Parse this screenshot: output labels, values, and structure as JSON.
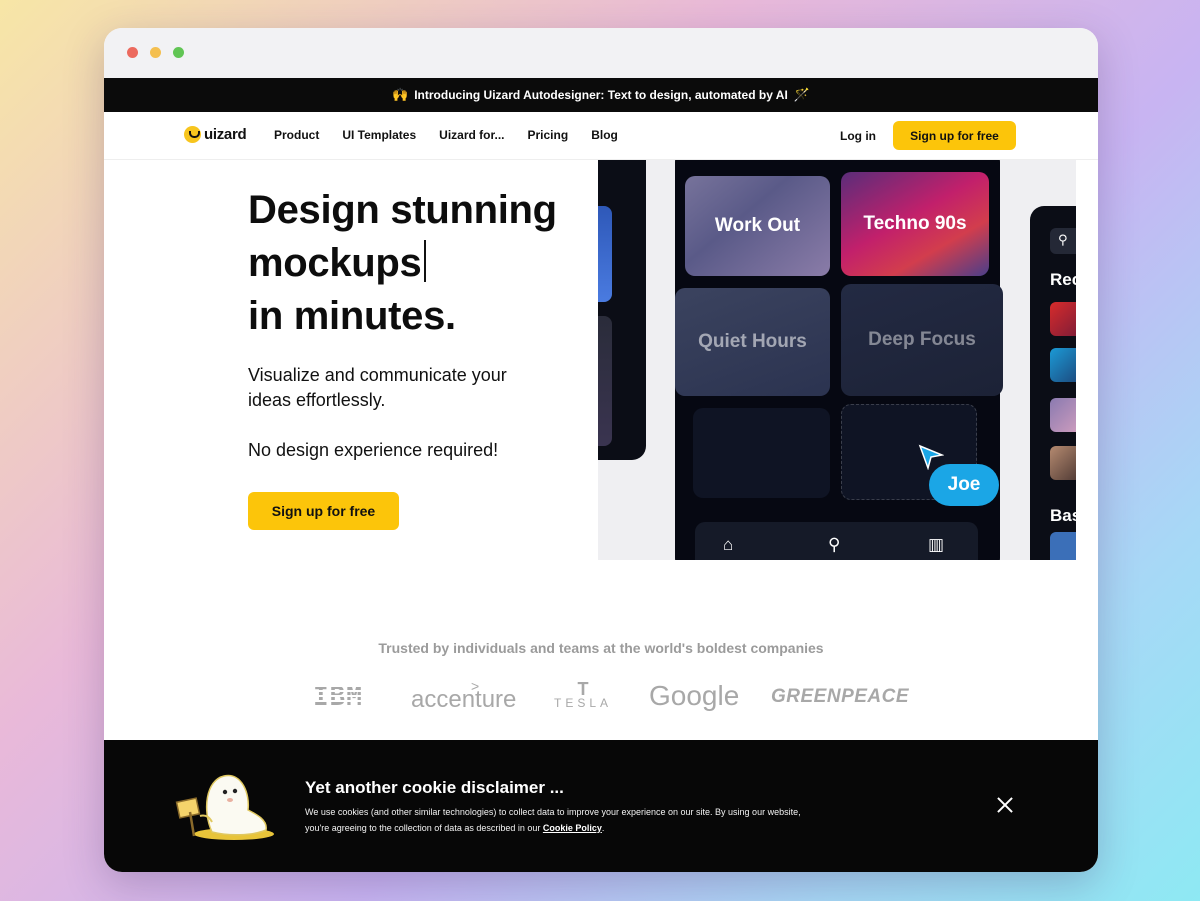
{
  "announcement": {
    "emoji_left": "🙌",
    "text": "Introducing Uizard Autodesigner: Text to design, automated by AI",
    "emoji_right": "🪄"
  },
  "nav": {
    "logo_text": "uizard",
    "links": [
      "Product",
      "UI Templates",
      "Uizard for...",
      "Pricing",
      "Blog"
    ],
    "login": "Log in",
    "cta": "Sign up for free"
  },
  "hero": {
    "headline_line1": "Design stunning",
    "headline_line2": "mockups",
    "headline_line3": "in minutes.",
    "subtitle": "Visualize and communicate your ideas effortlessly.",
    "subtitle2": "No design experience required!",
    "cta": "Sign up for free"
  },
  "mockup": {
    "tiles": [
      "Work Out",
      "Techno 90s",
      "Quiet Hours",
      "Deep Focus"
    ],
    "cursor_name": "Joe",
    "side_label_1": "Rec",
    "side_label_2": "Bas",
    "accent": "#1ba6e6"
  },
  "trusted": {
    "heading": "Trusted by individuals and teams at the world's boldest companies",
    "brands": [
      "IBM",
      "accenture",
      "TESLA",
      "Google",
      "GREENPEACE"
    ]
  },
  "cookie": {
    "title": "Yet another cookie disclaimer ...",
    "body": "We use cookies (and other similar technologies) to collect data to improve your experience on our site. By using our website, you're agreeing to the collection of data as described in our",
    "link": "Cookie Policy",
    "body_end": "."
  },
  "colors": {
    "brand_yellow": "#fcc50a",
    "dark": "#0b0b0b"
  }
}
